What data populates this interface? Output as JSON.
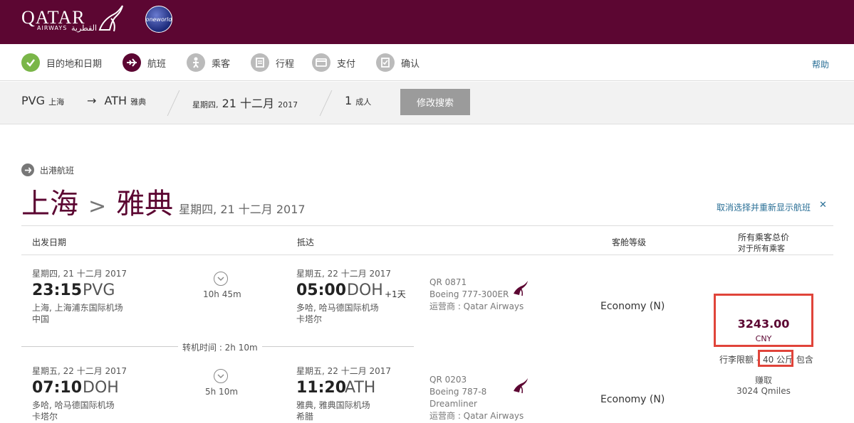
{
  "brand": {
    "name": "QATAR",
    "sub": "AIRWAYS",
    "arabic": "القطرية",
    "alliance": "oneworld",
    "color": "#5c0632"
  },
  "steps": [
    {
      "label": "目的地和日期",
      "icon": "check-icon",
      "state": "done"
    },
    {
      "label": "航班",
      "icon": "plane-icon",
      "state": "active"
    },
    {
      "label": "乘客",
      "icon": "passenger-icon",
      "state": "pending"
    },
    {
      "label": "行程",
      "icon": "itinerary-icon",
      "state": "pending"
    },
    {
      "label": "支付",
      "icon": "payment-icon",
      "state": "pending"
    },
    {
      "label": "确认",
      "icon": "confirm-icon",
      "state": "pending"
    }
  ],
  "help_label": "帮助",
  "search": {
    "origin_code": "PVG",
    "origin_city": "上海",
    "arrow": "→",
    "dest_code": "ATH",
    "dest_city": "雅典",
    "weekday": "星期四,",
    "day_month": "21 十二月",
    "year": "2017",
    "pax_count": "1",
    "pax_label": "成人",
    "modify_label": "修改搜索"
  },
  "outbound": {
    "label": "出港航班",
    "from": "上海",
    "sep": ">",
    "to": "雅典",
    "date": "星期四, 21 十二月 2017",
    "deselect": "取消选择并重新显示航班",
    "deselect_x": "✕"
  },
  "table": {
    "col_depart": "出发日期",
    "col_arrive": "抵达",
    "col_cabin": "客舱等级",
    "col_price": "所有乘客总价",
    "col_price_sub": "对于所有乘客"
  },
  "segments": [
    {
      "dep_date": "星期四, 21 十二月 2017",
      "dep_time": "23:15",
      "dep_code": "PVG",
      "dep_airport": "上海, 上海浦东国际机场",
      "dep_country": "中国",
      "duration": "10h 45m",
      "arr_date": "星期五, 22 十二月 2017",
      "arr_time": "05:00",
      "arr_code": "DOH",
      "arr_plus": "+1天",
      "arr_airport": "多哈, 哈马德国际机场",
      "arr_country": "卡塔尔",
      "flight_no": "QR 0871",
      "aircraft": "Boeing 777-300ER",
      "aircraft2": "",
      "operator": "运营商 : Qatar Airways",
      "cabin": "Economy (N)"
    },
    {
      "dep_date": "星期五, 22 十二月 2017",
      "dep_time": "07:10",
      "dep_code": "DOH",
      "dep_airport": "多哈, 哈马德国际机场",
      "dep_country": "卡塔尔",
      "duration": "5h 10m",
      "arr_date": "星期五, 22 十二月 2017",
      "arr_time": "11:20",
      "arr_code": "ATH",
      "arr_plus": "",
      "arr_airport": "雅典, 雅典国际机场",
      "arr_country": "希腊",
      "flight_no": "QR 0203",
      "aircraft": "Boeing 787-8",
      "aircraft2": "Dreamliner",
      "operator": "运营商 : Qatar Airways",
      "cabin": "Economy (N)"
    }
  ],
  "transfer": "转机时间 : 2h 10m",
  "price": {
    "amount": "3243.00",
    "currency": "CNY",
    "baggage_label": "行李限额 -",
    "baggage_value": "40 公斤",
    "baggage_suffix": "包含",
    "earn_label": "赚取",
    "earn_value": "3024 Qmiles"
  }
}
